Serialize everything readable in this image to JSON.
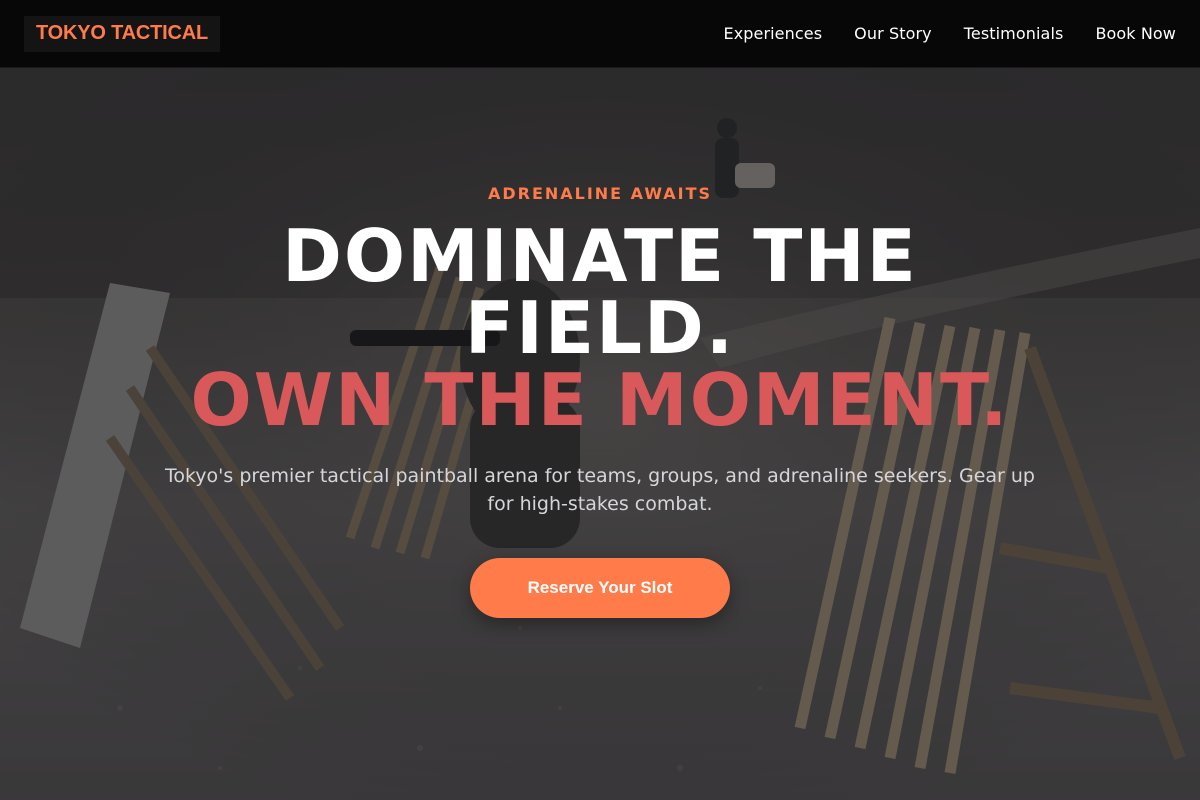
{
  "header": {
    "logo": "TOKYO TACTICAL",
    "nav": [
      {
        "label": "Experiences"
      },
      {
        "label": "Our Story"
      },
      {
        "label": "Testimonials"
      },
      {
        "label": "Book Now"
      }
    ]
  },
  "hero": {
    "eyebrow": "ADRENALINE AWAITS",
    "headline_line1": "DOMINATE THE FIELD.",
    "headline_line2": "OWN THE MOMENT.",
    "subtext": "Tokyo's premier tactical paintball arena for teams, groups, and adrenaline seekers. Gear up for high-stakes combat.",
    "cta_label": "Reserve Your Slot"
  },
  "colors": {
    "accent": "#ff7b4a",
    "headline_accent": "#d9595a",
    "header_bg": "#070707"
  }
}
